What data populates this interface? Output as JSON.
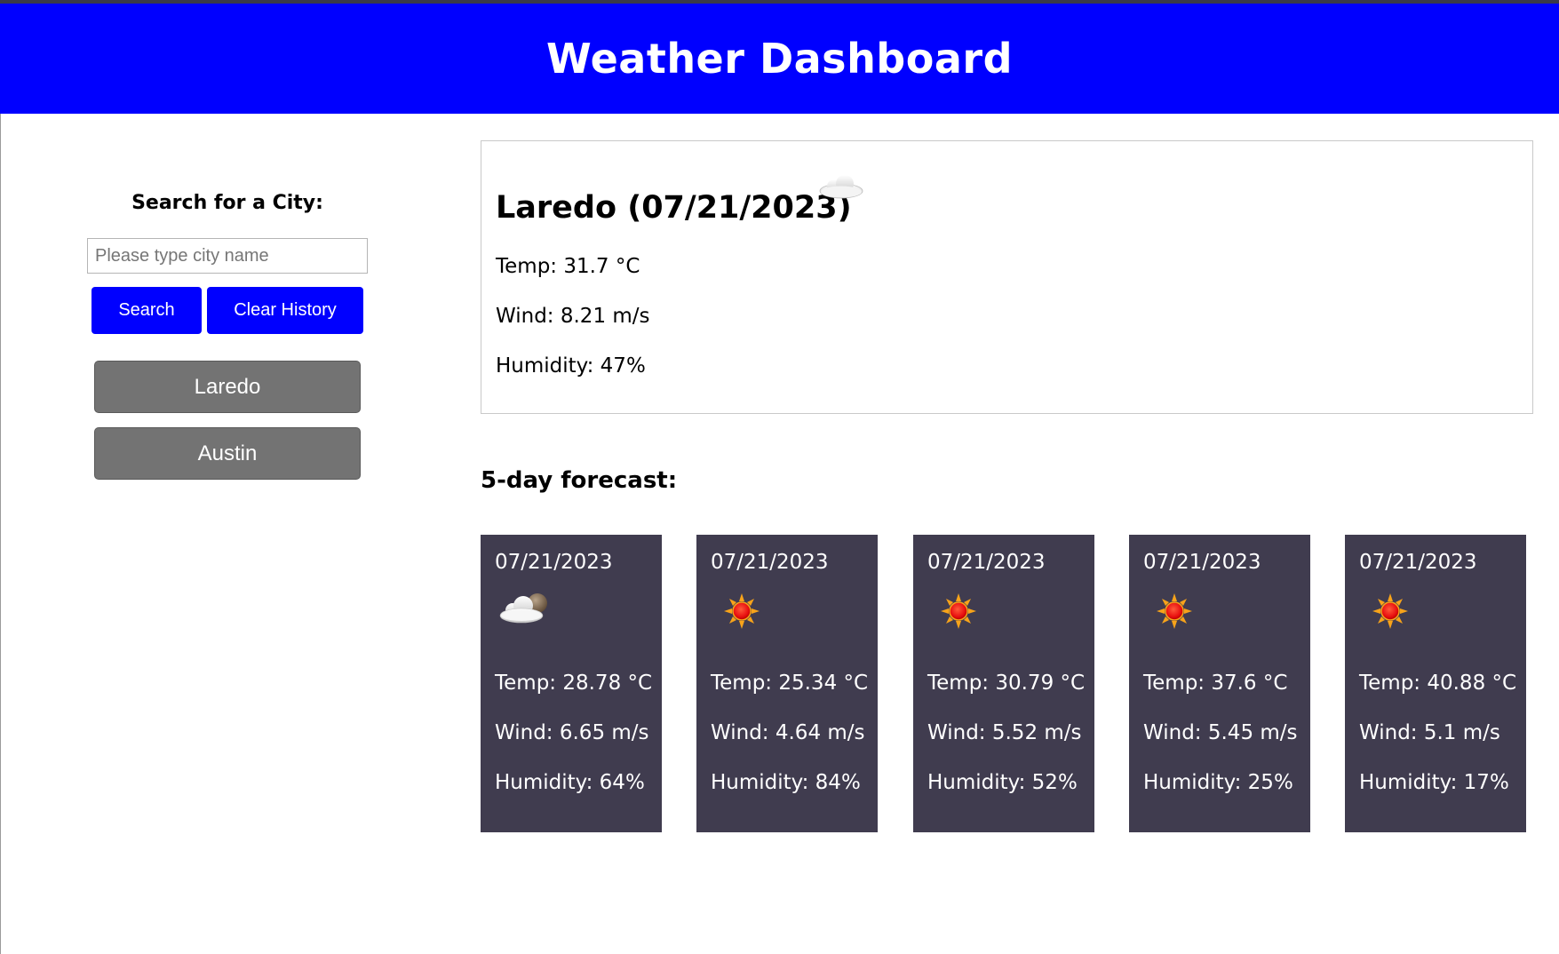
{
  "header": {
    "title": "Weather Dashboard"
  },
  "sidebar": {
    "search_label": "Search for a City:",
    "search_placeholder": "Please type city name",
    "search_value": "",
    "search_button": "Search",
    "clear_button": "Clear History",
    "history": [
      "Laredo",
      "Austin"
    ]
  },
  "current": {
    "title": "Laredo (07/21/2023)",
    "icon": "cloud-icon",
    "temp": "Temp: 31.7 °C",
    "wind": "Wind: 8.21 m/s",
    "humidity": "Humidity: 47%"
  },
  "forecast": {
    "heading": "5-day forecast:",
    "days": [
      {
        "date": "07/21/2023",
        "icon": "partly-cloudy-icon",
        "temp": "Temp: 28.78 °C",
        "wind": "Wind: 6.65 m/s",
        "humidity": "Humidity: 64%"
      },
      {
        "date": "07/21/2023",
        "icon": "sun-icon",
        "temp": "Temp: 25.34 °C",
        "wind": "Wind: 4.64 m/s",
        "humidity": "Humidity: 84%"
      },
      {
        "date": "07/21/2023",
        "icon": "sun-icon",
        "temp": "Temp: 30.79 °C",
        "wind": "Wind: 5.52 m/s",
        "humidity": "Humidity: 52%"
      },
      {
        "date": "07/21/2023",
        "icon": "sun-icon",
        "temp": "Temp: 37.6 °C",
        "wind": "Wind: 5.45 m/s",
        "humidity": "Humidity: 25%"
      },
      {
        "date": "07/21/2023",
        "icon": "sun-icon",
        "temp": "Temp: 40.88 °C",
        "wind": "Wind: 5.1 m/s",
        "humidity": "Humidity: 17%"
      }
    ]
  },
  "colors": {
    "header_bg": "#0000ff",
    "button_bg": "#0000ff",
    "history_bg": "#737373",
    "forecast_card_bg": "#403c4f"
  }
}
